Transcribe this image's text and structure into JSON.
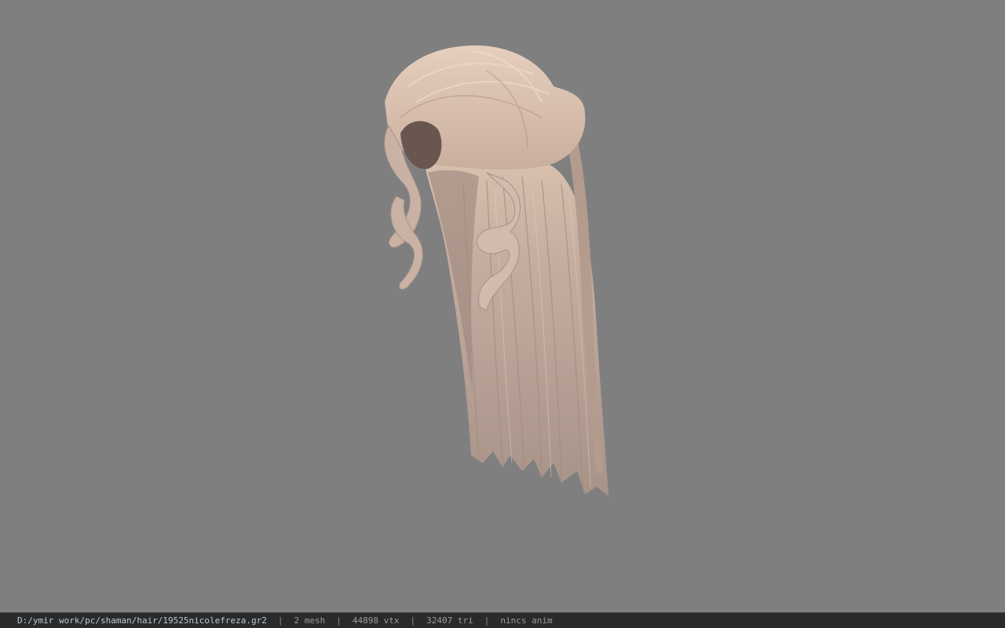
{
  "viewer": {
    "background_color": "#7f7f7f",
    "model_icon": "hair-model-icon"
  },
  "statusbar": {
    "file_path": "D:/ymir work/pc/shaman/hair/19525nicolefreza.gr2",
    "separator": "|",
    "mesh_count": "2 mesh",
    "vertex_count": "44898 vtx",
    "triangle_count": "32407 tri",
    "animation": "nincs anim"
  }
}
